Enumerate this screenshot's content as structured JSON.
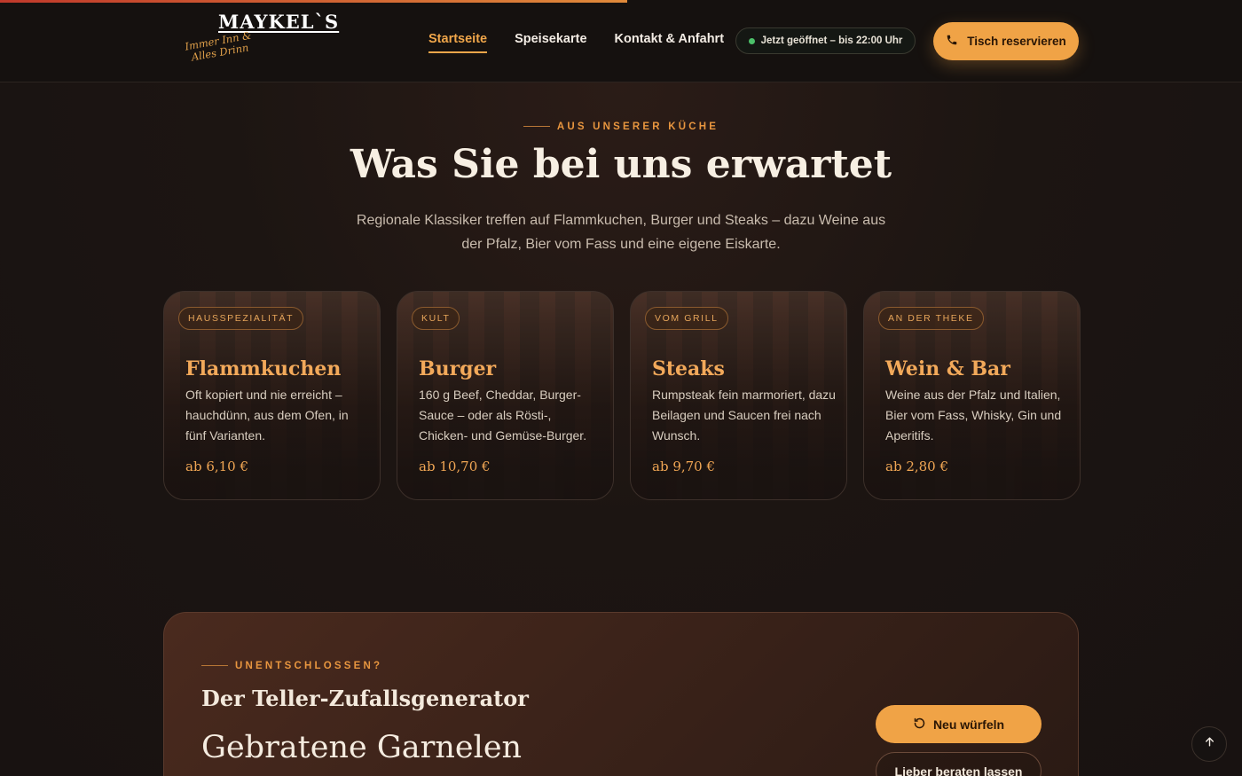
{
  "header": {
    "logo": {
      "name": "MAYKEL`S",
      "slogan": "Immer Inn & Alles Drinn"
    },
    "nav": [
      {
        "label": "Startseite",
        "active": true
      },
      {
        "label": "Speisekarte",
        "active": false
      },
      {
        "label": "Kontakt & Anfahrt",
        "active": false
      }
    ],
    "open_status": "Jetzt geöffnet – bis 22:00 Uhr",
    "reserve_label": "Tisch reservieren"
  },
  "section": {
    "eyebrow": "AUS UNSERER KÜCHE",
    "title": "Was Sie bei uns erwartet",
    "intro": "Regionale Klassiker treffen auf Flammkuchen, Burger und Steaks – dazu Weine aus der Pfalz, Bier vom Fass und eine eigene Eiskarte."
  },
  "cards": [
    {
      "tag": "HAUSSPEZIALITÄT",
      "title": "Flammkuchen",
      "text": "Oft kopiert und nie erreicht – hauchdünn, aus dem Ofen, in fünf Varianten.",
      "price": "ab 6,10 €"
    },
    {
      "tag": "KULT",
      "title": "Burger",
      "text": "160 g Beef, Cheddar, Burger-Sauce – oder als Rösti-, Chicken- und Gemüse-Burger.",
      "price": "ab 10,70 €"
    },
    {
      "tag": "VOM GRILL",
      "title": "Steaks",
      "text": "Rumpsteak fein marmoriert, dazu Beilagen und Saucen frei nach Wunsch.",
      "price": "ab 9,70 €"
    },
    {
      "tag": "AN DER THEKE",
      "title": "Wein & Bar",
      "text": "Weine aus der Pfalz und Italien, Bier vom Fass, Whisky, Gin und Aperitifs.",
      "price": "ab 2,80 €"
    }
  ],
  "generator": {
    "eyebrow": "UNENTSCHLOSSEN?",
    "title": "Der Teller-Zufallsgenerator",
    "dish": "Gebratene Garnelen",
    "roll_label": "Neu würfeln",
    "advice_label": "Lieber beraten lassen"
  },
  "colors": {
    "accent": "#f0a346",
    "background": "#1a1412",
    "open_dot": "#4cc16a"
  },
  "icons": {
    "reserve": "phone-icon",
    "roll": "refresh-icon",
    "to_top": "arrow-up-icon"
  }
}
